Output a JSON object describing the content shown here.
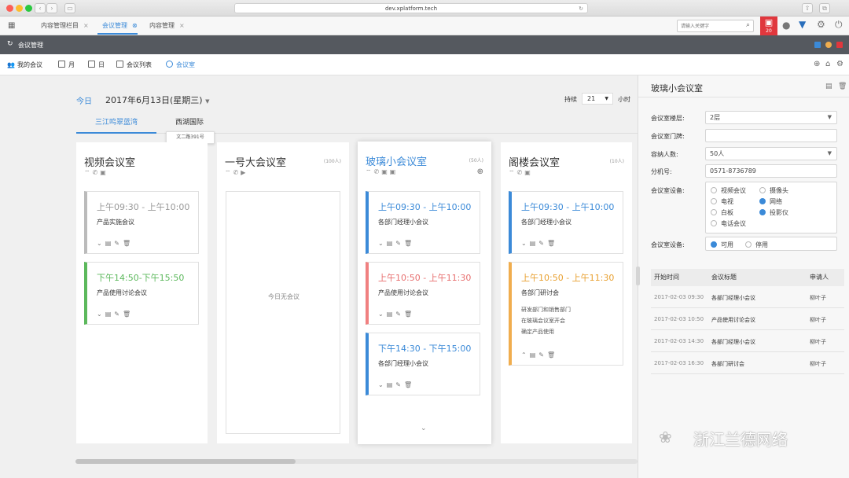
{
  "browser": {
    "url": "dev.xplatform.tech"
  },
  "tabs": [
    {
      "label": "内容管理栏目"
    },
    {
      "label": "会议管理"
    },
    {
      "label": "内容管理"
    }
  ],
  "header": {
    "search_placeholder": "请输入关键字",
    "notify_count": "20"
  },
  "subtitle": "会议管理",
  "toolbar": {
    "my_meetings": "我的会议",
    "month": "月",
    "day": "日",
    "meeting_list": "会议列表",
    "meeting_room": "会议室"
  },
  "datebar": {
    "today": "今日",
    "date": "2017年6月13日(星期三)",
    "duration_label": "持续",
    "duration_value": "21",
    "unit": "小时"
  },
  "locations": [
    {
      "label": "三江鸣翠蓝湾"
    },
    {
      "label": "西湖国际"
    }
  ],
  "tooltip": "文二路391号",
  "rooms": [
    {
      "name": "视频会议室",
      "capacity": "",
      "meetings": [
        {
          "time": "上午09:30 - 上午10:00",
          "title": "产品实施会议",
          "color": "#bbbbbb",
          "time_color": "#999999"
        },
        {
          "time": "下午14:50-下午15:50",
          "title": "产品使用讨论会议",
          "color": "#5cb85c",
          "time_color": "#5cb85c"
        }
      ]
    },
    {
      "name": "一号大会议室",
      "capacity": "(100人)",
      "empty_text": "今日无会议"
    },
    {
      "name": "玻璃小会议室",
      "capacity": "(50人)",
      "meetings": [
        {
          "time": "上午09:30 - 上午10:00",
          "title": "各部门经理小会议",
          "color": "#3b8ad8",
          "time_color": "#3b8ad8"
        },
        {
          "time": "上午10:50 - 上午11:30",
          "title": "产品使用讨论会议",
          "color": "#f08080",
          "time_color": "#e76f6f"
        },
        {
          "time": "下午14:30 - 下午15:00",
          "title": "各部门经理小会议",
          "color": "#3b8ad8",
          "time_color": "#3b8ad8"
        }
      ]
    },
    {
      "name": "阁楼会议室",
      "capacity": "(10人)",
      "meetings": [
        {
          "time": "上午09:30 - 上午10:00",
          "title": "各部门经理小会议",
          "color": "#3b8ad8",
          "time_color": "#3b8ad8"
        },
        {
          "time": "上午10:50 - 上午11:30",
          "title": "各部门研讨会",
          "color": "#f0ad4e",
          "time_color": "#e8a030",
          "desc": [
            "研发部门和销售部门",
            "在玻璃会议室开会",
            "确定产品使用"
          ]
        }
      ]
    }
  ],
  "panel": {
    "title": "玻璃小会议室",
    "fields": {
      "floor_label": "会议室楼层:",
      "floor_value": "2层",
      "plate_label": "会议室门牌:",
      "plate_value": "",
      "capacity_label": "容纳人数:",
      "capacity_value": "50人",
      "ext_label": "分机号:",
      "ext_value": "0571-8736789",
      "equip_label": "会议室设备:",
      "status_label": "会议室设备:",
      "status_on": "可用",
      "status_off": "停用"
    },
    "equipment": [
      {
        "label": "视频会议",
        "checked": false
      },
      {
        "label": "摄像头",
        "checked": false
      },
      {
        "label": "电视",
        "checked": false
      },
      {
        "label": "网络",
        "checked": true
      },
      {
        "label": "白板",
        "checked": false
      },
      {
        "label": "投影仪",
        "checked": true
      },
      {
        "label": "电话会议",
        "checked": false
      }
    ],
    "table_headers": {
      "start": "开始时间",
      "title": "会议标题",
      "applicant": "申请人"
    },
    "rows": [
      {
        "start": "2017-02-03 09:30",
        "title": "各部门经理小会议",
        "applicant": "柳叶子"
      },
      {
        "start": "2017-02-03 10:50",
        "title": "产品使用讨论会议",
        "applicant": "柳叶子"
      },
      {
        "start": "2017-02-03 14:30",
        "title": "各部门经理小会议",
        "applicant": "柳叶子"
      },
      {
        "start": "2017-02-03 16:30",
        "title": "各部门研讨会",
        "applicant": "柳叶子"
      }
    ]
  },
  "watermark": "浙江兰德网络"
}
